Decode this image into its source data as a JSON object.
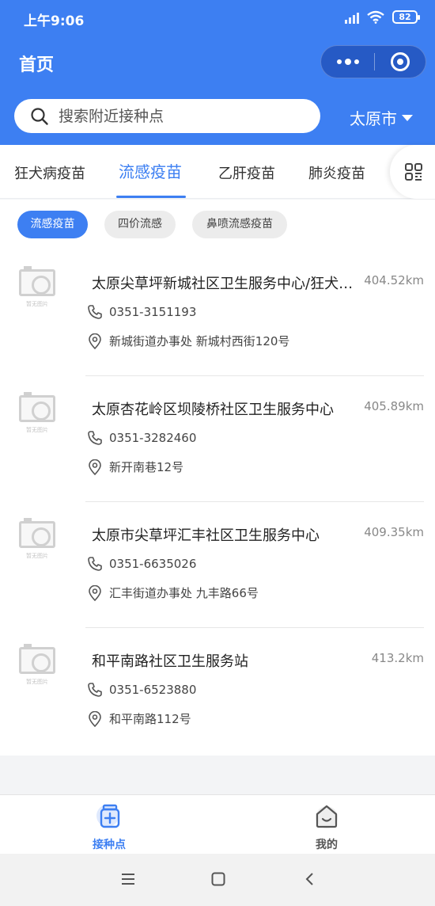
{
  "status_bar": {
    "time": "上午9:06",
    "battery": "82"
  },
  "header": {
    "title": "首页"
  },
  "search": {
    "placeholder": "搜索附近接种点",
    "city": "太原市"
  },
  "tabs": [
    {
      "label": "狂犬病疫苗",
      "active": false
    },
    {
      "label": "流感疫苗",
      "active": true
    },
    {
      "label": "乙肝疫苗",
      "active": false
    },
    {
      "label": "肺炎疫苗",
      "active": false
    }
  ],
  "chips": [
    {
      "label": "流感疫苗",
      "active": true
    },
    {
      "label": "四价流感",
      "active": false
    },
    {
      "label": "鼻喷流感疫苗",
      "active": false
    }
  ],
  "no_image_caption": "暂无图片",
  "clinics": [
    {
      "name": "太原尖草坪新城社区卫生服务中心/狂犬病防治门诊",
      "distance": "404.52km",
      "phone": "0351-3151193",
      "address": "新城街道办事处 新城村西街120号"
    },
    {
      "name": "太原杏花岭区坝陵桥社区卫生服务中心",
      "distance": "405.89km",
      "phone": "0351-3282460",
      "address": "新开南巷12号"
    },
    {
      "name": "太原市尖草坪汇丰社区卫生服务中心",
      "distance": "409.35km",
      "phone": "0351-6635026",
      "address": "汇丰街道办事处 九丰路66号"
    },
    {
      "name": "和平南路社区卫生服务站",
      "distance": "413.2km",
      "phone": "0351-6523880",
      "address": "和平南路112号"
    }
  ],
  "bottom_nav": [
    {
      "label": "接种点",
      "icon": "vaccine-bottle-icon",
      "active": true
    },
    {
      "label": "我的",
      "icon": "house-smile-icon",
      "active": false
    }
  ],
  "colors": {
    "primary": "#3d7ff2"
  }
}
